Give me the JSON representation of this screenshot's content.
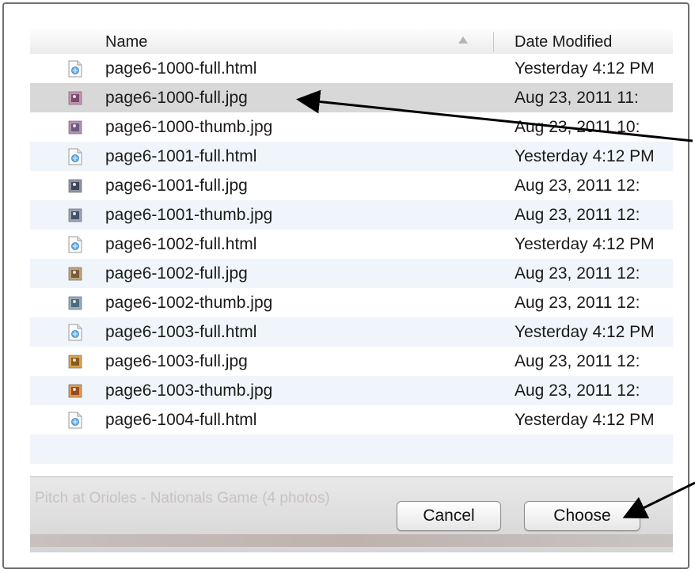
{
  "table": {
    "columns": {
      "name": "Name",
      "date": "Date Modified"
    },
    "rows": [
      {
        "name": "page6-1000-full.html",
        "date": "Yesterday 4:12 PM",
        "icon": "html-file-icon"
      },
      {
        "name": "page6-1000-full.jpg",
        "date": "Aug 23, 2011 11:",
        "icon": "jpg-thumbnail-icon"
      },
      {
        "name": "page6-1000-thumb.jpg",
        "date": "Aug 23, 2011 10:",
        "icon": "jpg-thumbnail-icon"
      },
      {
        "name": "page6-1001-full.html",
        "date": "Yesterday 4:12 PM",
        "icon": "html-file-icon"
      },
      {
        "name": "page6-1001-full.jpg",
        "date": "Aug 23, 2011 12:",
        "icon": "jpg-thumbnail-icon"
      },
      {
        "name": "page6-1001-thumb.jpg",
        "date": "Aug 23, 2011 12:",
        "icon": "jpg-thumbnail-icon"
      },
      {
        "name": "page6-1002-full.html",
        "date": "Yesterday 4:12 PM",
        "icon": "html-file-icon"
      },
      {
        "name": "page6-1002-full.jpg",
        "date": "Aug 23, 2011 12:",
        "icon": "jpg-thumbnail-icon"
      },
      {
        "name": "page6-1002-thumb.jpg",
        "date": "Aug 23, 2011 12:",
        "icon": "jpg-thumbnail-icon"
      },
      {
        "name": "page6-1003-full.html",
        "date": "Yesterday 4:12 PM",
        "icon": "html-file-icon"
      },
      {
        "name": "page6-1003-full.jpg",
        "date": "Aug 23, 2011 12:",
        "icon": "jpg-thumbnail-icon"
      },
      {
        "name": "page6-1003-thumb.jpg",
        "date": "Aug 23, 2011 12:",
        "icon": "jpg-thumbnail-icon"
      },
      {
        "name": "page6-1004-full.html",
        "date": "Yesterday 4:12 PM",
        "icon": "html-file-icon"
      }
    ],
    "selected_index": 1
  },
  "footer": {
    "background_text": "Pitch at Orioles - Nationals Game (4 photos)",
    "cancel_label": "Cancel",
    "choose_label": "Choose"
  },
  "colors": {
    "selected_row": "#d8d8d8",
    "alt_row": "#f0f5fb",
    "annotation_arrow": "#000000"
  }
}
